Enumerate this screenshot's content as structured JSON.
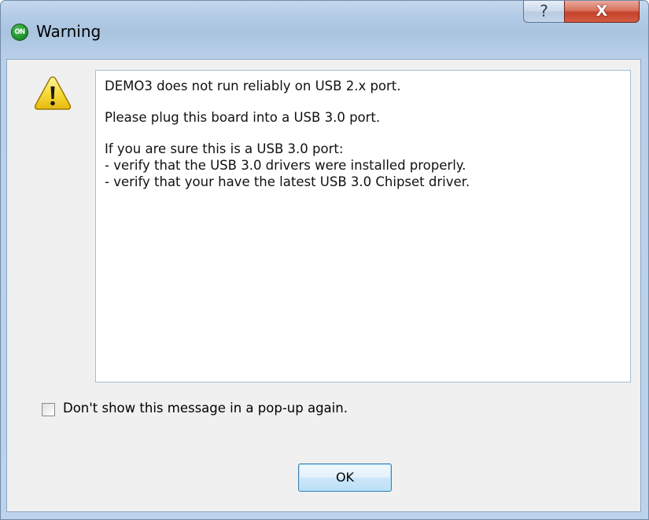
{
  "window": {
    "title": "Warning",
    "app_icon_text": "ON",
    "help_button_label": "?",
    "close_button_label": "X"
  },
  "icons": {
    "app": "on-semiconductor-logo-icon",
    "message": "warning-triangle-icon"
  },
  "message": {
    "lines": [
      "DEMO3 does not run reliably on USB 2.x port.",
      "Please plug this board into a USB 3.0 port.",
      "If you are sure this is a USB 3.0 port:",
      "- verify that the USB 3.0 drivers were installed properly.",
      "- verify that your have the latest USB 3.0 Chipset driver."
    ]
  },
  "checkbox": {
    "label": "Don't show this message in a pop-up again.",
    "checked": false
  },
  "ok_button": {
    "label": "OK"
  },
  "colors": {
    "close_button": "#c4412a",
    "app_icon_green": "#1f8a2a",
    "warning_yellow": "#f5d634",
    "ok_button_border": "#3c7fb1"
  }
}
